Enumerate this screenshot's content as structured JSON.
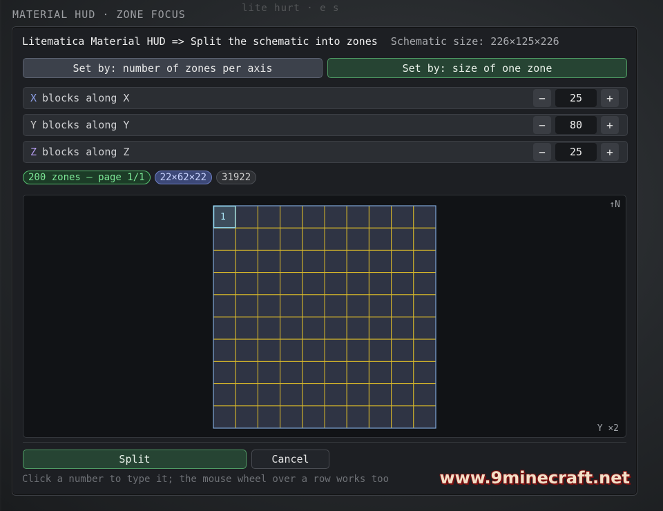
{
  "window": {
    "title": "MATERIAL HUD · ZONE FOCUS"
  },
  "header": {
    "title": "Litematica Material HUD => Split the schematic into zones",
    "schematic_size": "Schematic size: 226×125×226"
  },
  "mode": {
    "by_zone_count": "Set by: number of zones per axis",
    "by_zone_size": "Set by: size of one zone",
    "active": "by_zone_size"
  },
  "axes": [
    {
      "axis": "X",
      "label": "blocks along X",
      "value": "25",
      "minus": "−",
      "plus": "+"
    },
    {
      "axis": "Y",
      "label": "blocks along Y",
      "value": "80",
      "minus": "−",
      "plus": "+"
    },
    {
      "axis": "Z",
      "label": "blocks along Z",
      "value": "25",
      "minus": "−",
      "plus": "+"
    }
  ],
  "chips": {
    "zones": "200 zones — page 1/1",
    "zone_dims": "22×62×22",
    "count": "31922"
  },
  "map": {
    "north": "↑N",
    "layer_scale": "Y ×2",
    "columns": 10,
    "rows": 10,
    "selected_label": "1",
    "grid_line_color": "#d9b92a",
    "cell_color": "#2f3444",
    "border_color": "#7fa6d8"
  },
  "actions": {
    "split": "Split",
    "cancel": "Cancel"
  },
  "hint": "Click a number to type it; the mouse wheel over a row works too",
  "watermark": "www.9minecraft.net",
  "background_text": "lite     hurt  ·  e     s"
}
